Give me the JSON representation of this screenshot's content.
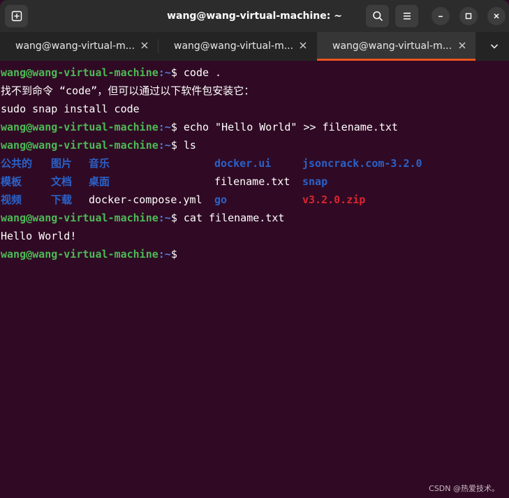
{
  "window": {
    "title": "wang@wang-virtual-machine: ~"
  },
  "tabs": [
    {
      "label": "wang@wang-virtual-m...",
      "active": false
    },
    {
      "label": "wang@wang-virtual-m...",
      "active": false
    },
    {
      "label": "wang@wang-virtual-m...",
      "active": true
    }
  ],
  "prompt": {
    "user": "wang@wang-virtual-machine",
    "path": ":~",
    "symbol": "$ "
  },
  "terminal": {
    "cmd1": "code .",
    "out1a": "找不到命令 “code”，但可以通过以下软件包安装它：",
    "out1b": "sudo snap install code",
    "cmd2": "echo \"Hello World\" >> filename.txt",
    "cmd3": "ls",
    "ls_rows": [
      [
        {
          "text": "公共的",
          "kind": "dir"
        },
        {
          "text": "图片",
          "kind": "dir"
        },
        {
          "text": "音乐",
          "kind": "dir"
        },
        {
          "text": "",
          "kind": "file"
        },
        {
          "text": "docker.ui",
          "kind": "dir"
        },
        {
          "text": "jsoncrack.com-3.2.0",
          "kind": "dir"
        }
      ],
      [
        {
          "text": "模板",
          "kind": "dir"
        },
        {
          "text": "文档",
          "kind": "dir"
        },
        {
          "text": "桌面",
          "kind": "dir"
        },
        {
          "text": "",
          "kind": "file"
        },
        {
          "text": "filename.txt",
          "kind": "file"
        },
        {
          "text": "snap",
          "kind": "dir"
        }
      ],
      [
        {
          "text": "视频",
          "kind": "dir"
        },
        {
          "text": "下载",
          "kind": "dir"
        },
        {
          "text": "docker-compose.yml",
          "kind": "file"
        },
        {
          "text": "",
          "kind": "file"
        },
        {
          "text": "go",
          "kind": "dir"
        },
        {
          "text": "v3.2.0.zip",
          "kind": "zip"
        }
      ]
    ],
    "cmd4": "cat filename.txt",
    "out4": "Hello World!"
  },
  "watermark": "CSDN @热爱技术。",
  "colors": {
    "background": "#300a24",
    "prompt_user": "#4cba55",
    "prompt_path": "#4f7bd6",
    "directory": "#2a62c9",
    "archive": "#d9252f",
    "tab_accent": "#e95420"
  },
  "icons": {
    "new_tab": "new-tab-icon",
    "search": "search-icon",
    "menu": "hamburger-menu-icon",
    "minimize": "minimize-icon",
    "maximize": "maximize-icon",
    "close": "close-icon",
    "tab_close": "close-icon",
    "tabs_overflow": "chevron-down-icon"
  }
}
